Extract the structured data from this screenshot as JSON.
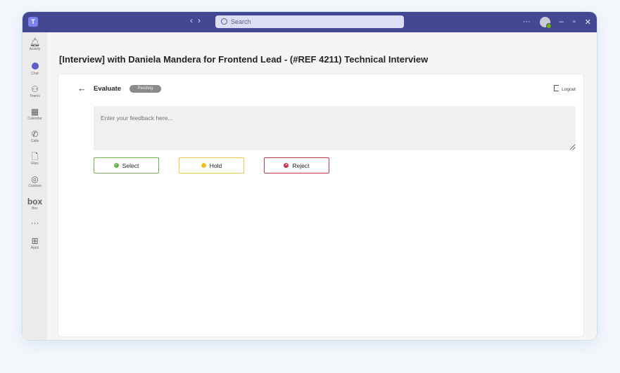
{
  "titlebar": {
    "app_logo": "T",
    "nav_back": "‹",
    "nav_forward": "›",
    "search_placeholder": "Search",
    "more": "···",
    "minimize": "–",
    "maximize": "▫",
    "close": "✕"
  },
  "rail": {
    "items": [
      {
        "icon": "bell-icon",
        "glyph": "🔔︎",
        "label": "Activity"
      },
      {
        "icon": "chat-icon",
        "glyph": "",
        "label": "Chat"
      },
      {
        "icon": "teams-icon",
        "glyph": "⚇",
        "label": "Teams"
      },
      {
        "icon": "calendar-icon",
        "glyph": "▦",
        "label": "Calendar"
      },
      {
        "icon": "phone-icon",
        "glyph": "✆",
        "label": "Calls"
      },
      {
        "icon": "file-icon",
        "glyph": "🗋︎",
        "label": "Files"
      },
      {
        "icon": "contoso-icon",
        "glyph": "◎",
        "label": "Contoso"
      },
      {
        "icon": "box-icon",
        "glyph": "box",
        "label": "Box"
      },
      {
        "icon": "more-icon",
        "glyph": "···",
        "label": ""
      },
      {
        "icon": "apps-icon",
        "glyph": "⊞",
        "label": "Apps"
      }
    ],
    "active_index": 1
  },
  "main": {
    "meeting_title": "[Interview] with Daniela Mandera for Frontend Lead - (#REF 4211) Technical Interview"
  },
  "evaluate": {
    "back_glyph": "←",
    "title": "Evaluate",
    "status_badge": "Pending",
    "logout_label": "Logout",
    "feedback_placeholder": "Enter your feedback here...",
    "buttons": {
      "select": "Select",
      "hold": "Hold",
      "reject": "Reject"
    }
  },
  "colors": {
    "titlebar": "#444791",
    "accent": "#5b5fc7",
    "select": "#6bb34a",
    "hold": "#f2c11b",
    "reject": "#c4314b"
  }
}
